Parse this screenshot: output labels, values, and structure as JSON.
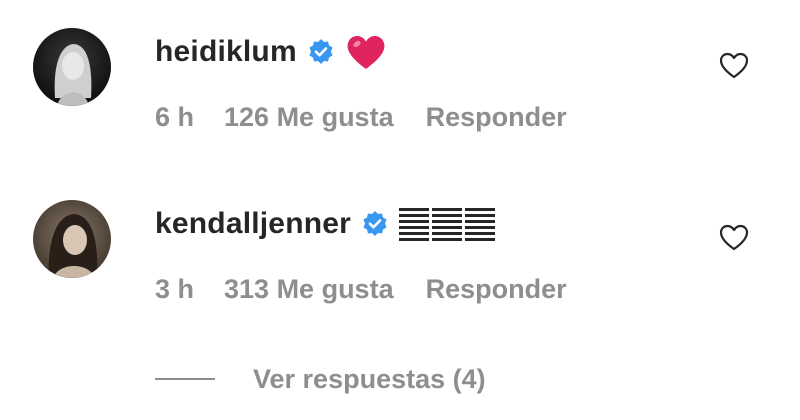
{
  "comments": [
    {
      "username": "heidiklum",
      "verified": true,
      "text_emoji": "heart-emoji",
      "time": "6 h",
      "likes": "126 Me gusta",
      "reply_label": "Responder"
    },
    {
      "username": "kendalljenner",
      "verified": true,
      "text_emoji": "bars-emoji",
      "time": "3 h",
      "likes": "313 Me gusta",
      "reply_label": "Responder"
    }
  ],
  "view_replies_label": "Ver respuestas (4)",
  "colors": {
    "text": "#262626",
    "secondary": "#8e8e8e",
    "verified_blue": "#3897f0",
    "heart_red": "#e0245e"
  }
}
